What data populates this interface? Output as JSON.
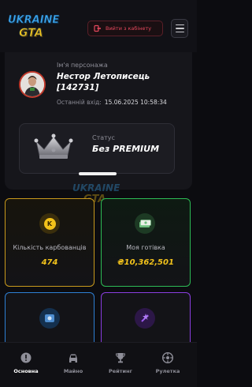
{
  "header": {
    "logo_line1": "UKRAINE",
    "logo_line2": "GTA",
    "exit_label": "Вийти з кабінету"
  },
  "profile": {
    "char_label": "Ім'я персонажа",
    "char_name": "Нестор Летописець [142731]",
    "last_login_label": "Останній вхід:",
    "last_login_value": "15.06.2025 10:58:34",
    "status_label": "Статус",
    "status_value": "Без PREMIUM"
  },
  "tiles": {
    "karbovantsi_label": "Кількість карбованців",
    "karbovantsi_value": "474",
    "cash_label": "Моя готівка",
    "cash_value": "₴10,362,501",
    "coin_glyph": "K"
  },
  "nav": {
    "items": [
      {
        "label": "Основна",
        "icon": "info-icon"
      },
      {
        "label": "Майно",
        "icon": "car-icon"
      },
      {
        "label": "Рейтинг",
        "icon": "trophy-icon"
      },
      {
        "label": "Рулетка",
        "icon": "roulette-icon"
      }
    ]
  },
  "colors": {
    "gold": "#c99a1c",
    "green": "#2dbb55",
    "blue": "#2e7fd4",
    "purple": "#8a3ee0",
    "exit_red": "#e5485d"
  }
}
